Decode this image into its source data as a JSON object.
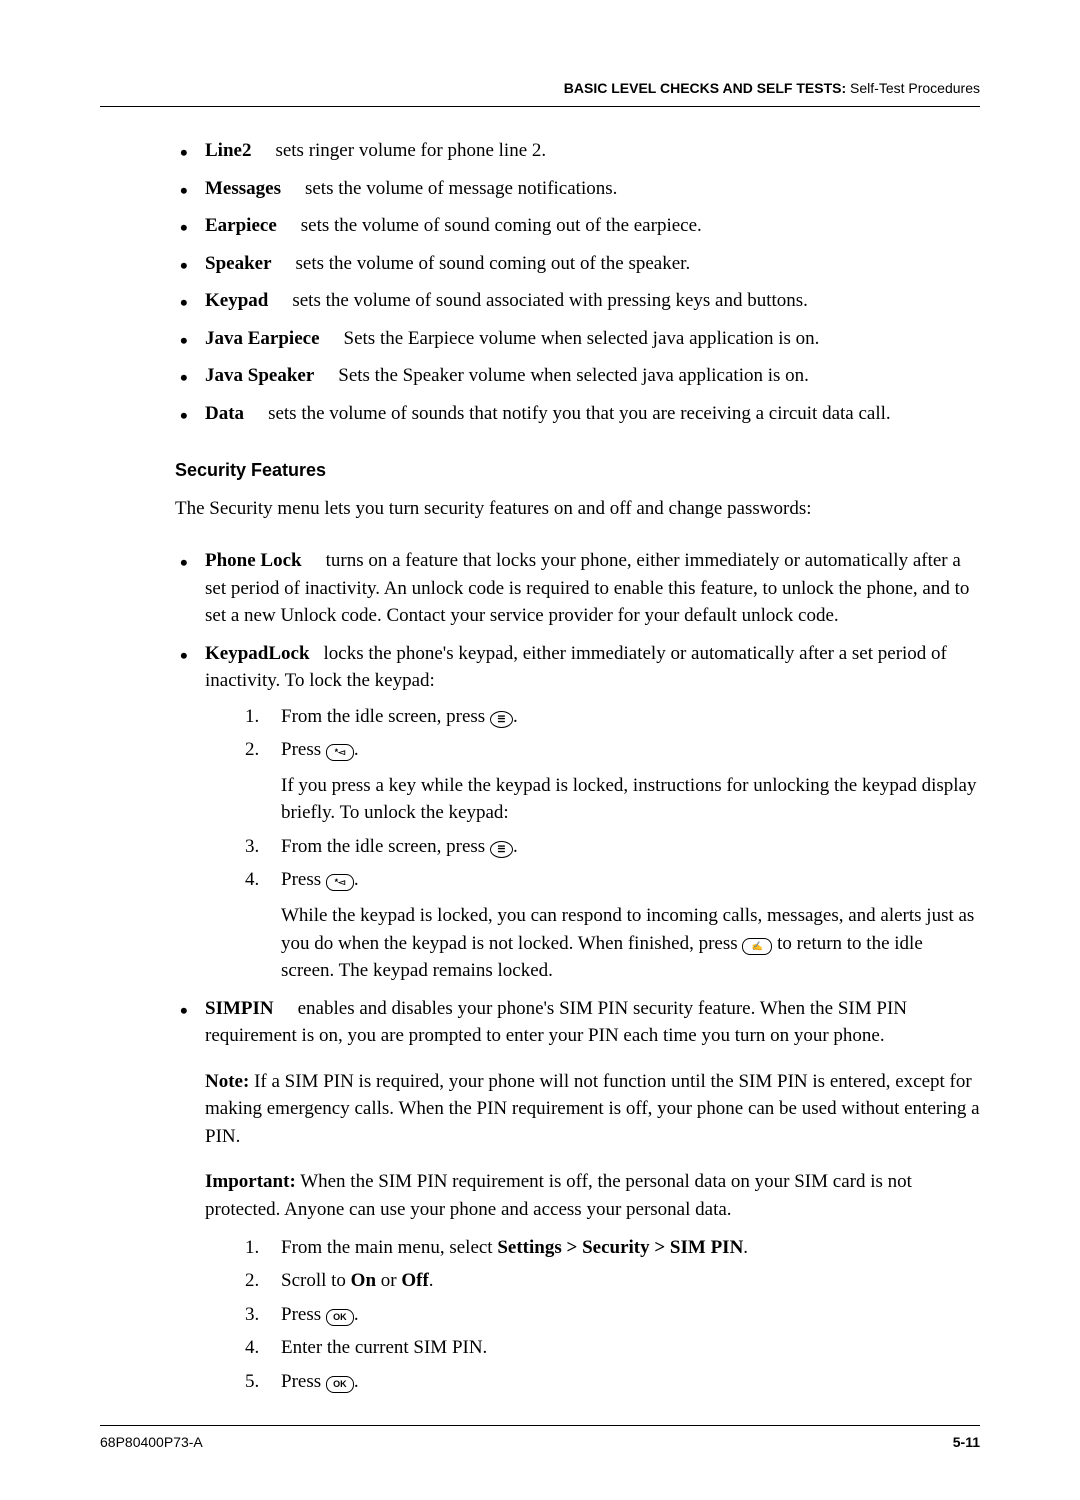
{
  "header": {
    "bold": "BASIC LEVEL CHECKS AND SELF TESTS: ",
    "light": "Self-Test Procedures"
  },
  "bullets1": [
    {
      "term": "Line2",
      "desc": "sets ringer volume for phone line 2."
    },
    {
      "term": "Messages",
      "desc": "sets the volume of message notifications."
    },
    {
      "term": "Earpiece",
      "desc": "sets the volume of sound coming out of the earpiece."
    },
    {
      "term": "Speaker",
      "desc": "sets the volume of sound coming out of the speaker."
    },
    {
      "term": "Keypad",
      "desc": "sets the volume of sound associated with pressing keys and buttons."
    },
    {
      "term": "Java Earpiece",
      "desc": "Sets the Earpiece volume when selected java application is on."
    },
    {
      "term": "Java Speaker",
      "desc": "Sets the Speaker volume when selected java application is on."
    },
    {
      "term": "Data",
      "desc": "sets the volume of sounds that notify you that you are receiving a circuit data call."
    }
  ],
  "section_title": "Security Features",
  "intro": "The Security menu lets you turn security features on and off and change passwords:",
  "sec": {
    "phone_lock": {
      "term": "Phone Lock",
      "desc": "turns on a feature that locks your phone, either immediately or automatically after a set period of inactivity. An unlock code is required to enable this feature, to unlock the phone, and to set a new Unlock code. Contact your service provider for your default unlock code."
    },
    "keypad_lock": {
      "term": "KeypadLock",
      "desc": "locks the phone's keypad, either immediately or automatically after a set period of inactivity. To lock the keypad:"
    },
    "keypad_steps": {
      "s1_a": "From the idle screen, press ",
      "s1_b": ".",
      "s2_a": "Press ",
      "s2_b": ".",
      "s2_c": "If you press a key while the keypad is locked, instructions for unlocking the keypad display briefly. To unlock the keypad:",
      "s3_a": "From the idle screen, press ",
      "s3_b": ".",
      "s4_a": "Press ",
      "s4_b": ".",
      "s4_c_pref": "While the keypad is locked, you can respond to incoming calls, messages, and alerts just as you do when the keypad is not locked. When finished, press ",
      "s4_c_suf": " to return to the idle screen. The keypad remains locked."
    },
    "simpin": {
      "term": "SIMPIN",
      "desc": "enables and disables your phone's SIM PIN security feature. When the SIM PIN requirement is on, you are prompted to enter your PIN each time you turn on your phone."
    },
    "note_label": "Note:",
    "note_text": " If a SIM PIN is required, your phone will not function until the SIM PIN is entered, except for making emergency calls. When the PIN requirement is off, your phone can be used without entering a PIN.",
    "important_label": "Important:",
    "important_text": " When the SIM PIN requirement is off, the personal data on your SIM card is not protected. Anyone can use your phone and access your personal data.",
    "sim_steps": {
      "s1_a": "From the main menu, select ",
      "s1_b": "Settings > Security > SIM PIN",
      "s1_c": ".",
      "s2_a": "Scroll to ",
      "s2_b": "On",
      "s2_c": " or ",
      "s2_d": "Off",
      "s2_e": ".",
      "s3_a": "Press ",
      "s3_b": ".",
      "s4": "Enter the current SIM PIN.",
      "s5_a": "Press ",
      "s5_b": "."
    }
  },
  "icons": {
    "menu": "☰",
    "star": "*◅",
    "end": "✍",
    "ok": "OK"
  },
  "footer": {
    "left": "68P80400P73-A",
    "right": "5-11"
  }
}
